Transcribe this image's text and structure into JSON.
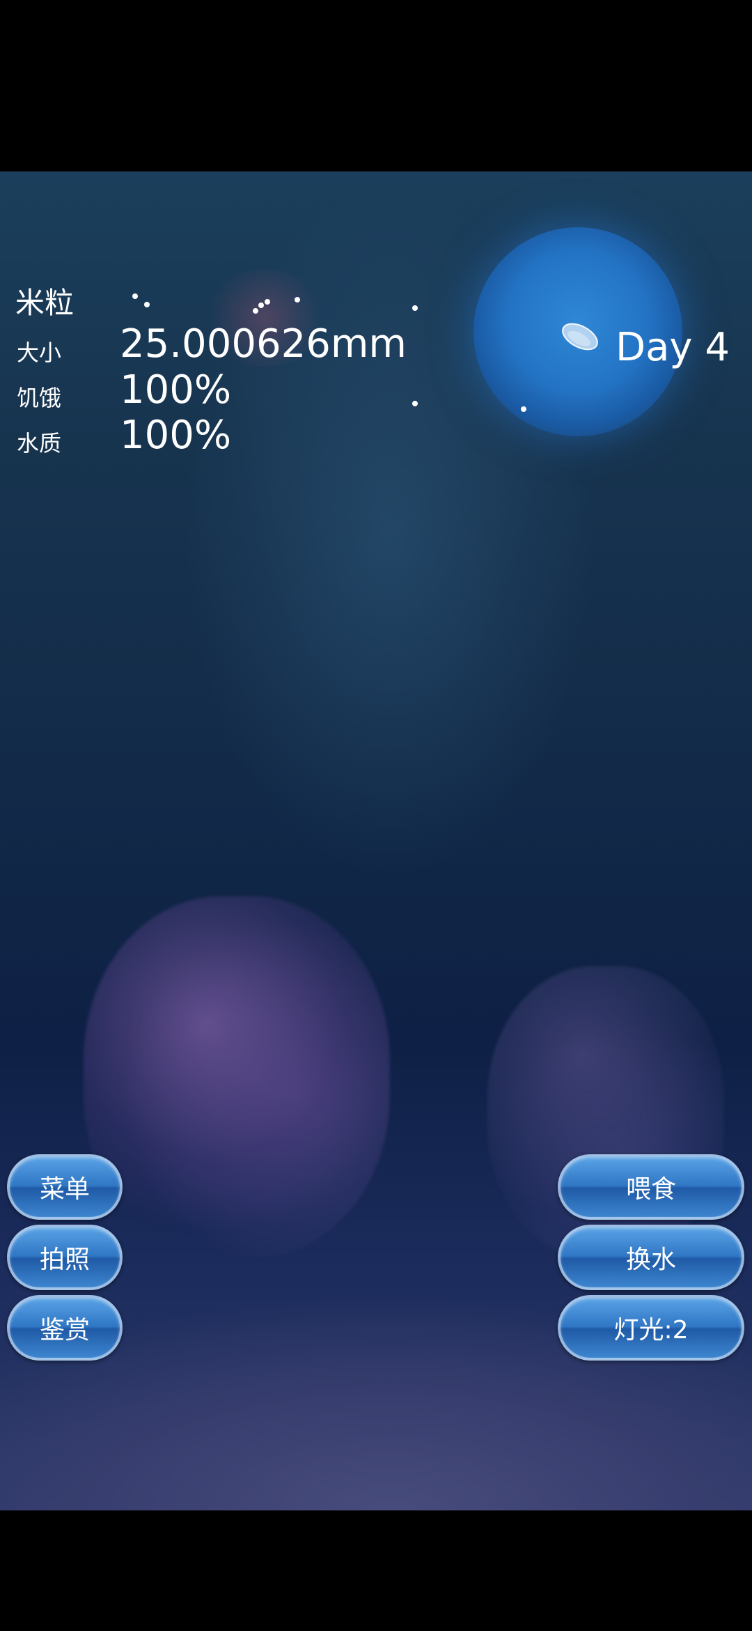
{
  "stats": {
    "name": "米粒",
    "size_label": "大小",
    "size_value": "25.000626mm",
    "hunger_label": "饥饿",
    "hunger_value": "100%",
    "water_label": "水质",
    "water_value": "100%"
  },
  "day": "Day 4",
  "buttons_left": {
    "menu": "菜单",
    "photo": "拍照",
    "appreciate": "鉴赏"
  },
  "buttons_right": {
    "feed": "喂食",
    "change_water": "换水",
    "light": "灯光:2"
  },
  "colors": {
    "water_top": "#1b3f5c",
    "water_bottom": "#2b3a6a",
    "moon": "#2f87d6",
    "button": "#2f76c4"
  },
  "icons": {
    "creature": "jellyfish-icon"
  }
}
